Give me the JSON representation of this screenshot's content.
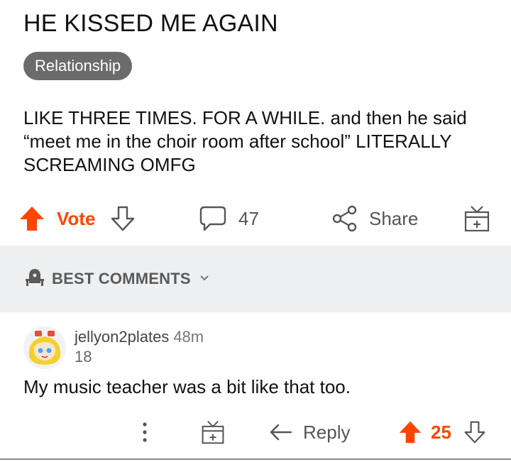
{
  "post": {
    "title": "HE KISSED ME AGAIN",
    "flair": "Relationship",
    "body": "LIKE THREE TIMES.  FOR A WHILE.  and then he said “meet me in the choir room after school” LITERALLY SCREAMING OMFG"
  },
  "actions": {
    "vote_label": "Vote",
    "comment_count": "47",
    "share_label": "Share"
  },
  "sort": {
    "label": "BEST COMMENTS"
  },
  "comment": {
    "username": "jellyon2plates",
    "time": "48m",
    "score_line": "18",
    "body": "My music teacher was a bit like that too.",
    "reply_label": "Reply",
    "votes": "25"
  },
  "colors": {
    "accent": "#ff4500",
    "flair_bg": "#6b6b6b",
    "sort_bg": "#edeff1"
  },
  "icons": [
    "upvote-icon",
    "downvote-icon",
    "comment-icon",
    "share-icon",
    "award-icon",
    "mod-shield-icon",
    "chevron-down-icon",
    "more-icon",
    "reply-icon"
  ]
}
